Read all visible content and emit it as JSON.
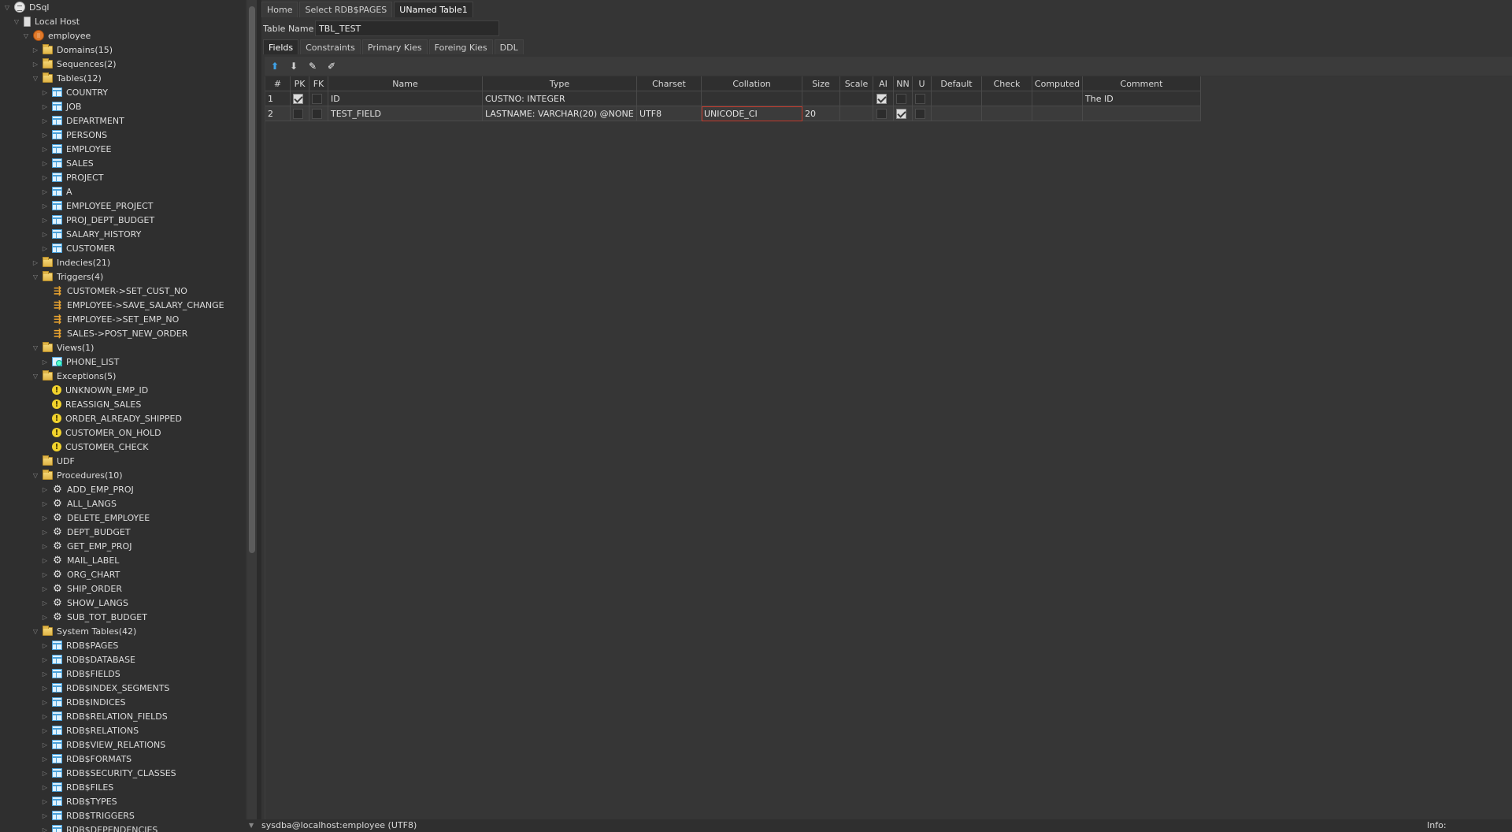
{
  "tree": [
    {
      "label": "DSql",
      "icon": "database-icon",
      "level": 0,
      "arrow": "open"
    },
    {
      "label": "Local Host",
      "icon": "server-icon",
      "level": 1,
      "arrow": "open"
    },
    {
      "label": "employee",
      "icon": "database-connection-icon",
      "level": 2,
      "arrow": "open"
    },
    {
      "label": "Domains(15)",
      "icon": "folder-icon",
      "level": 3,
      "arrow": "closed"
    },
    {
      "label": "Sequences(2)",
      "icon": "folder-icon",
      "level": 3,
      "arrow": "closed"
    },
    {
      "label": "Tables(12)",
      "icon": "folder-icon",
      "level": 3,
      "arrow": "open"
    },
    {
      "label": "COUNTRY",
      "icon": "table-icon",
      "level": 4,
      "arrow": "closed"
    },
    {
      "label": "JOB",
      "icon": "table-icon",
      "level": 4,
      "arrow": "closed"
    },
    {
      "label": "DEPARTMENT",
      "icon": "table-icon",
      "level": 4,
      "arrow": "closed"
    },
    {
      "label": "PERSONS",
      "icon": "table-icon",
      "level": 4,
      "arrow": "closed"
    },
    {
      "label": "EMPLOYEE",
      "icon": "table-icon",
      "level": 4,
      "arrow": "closed"
    },
    {
      "label": "SALES",
      "icon": "table-icon",
      "level": 4,
      "arrow": "closed"
    },
    {
      "label": "PROJECT",
      "icon": "table-icon",
      "level": 4,
      "arrow": "closed"
    },
    {
      "label": "A",
      "icon": "table-icon",
      "level": 4,
      "arrow": "closed"
    },
    {
      "label": "EMPLOYEE_PROJECT",
      "icon": "table-icon",
      "level": 4,
      "arrow": "closed"
    },
    {
      "label": "PROJ_DEPT_BUDGET",
      "icon": "table-icon",
      "level": 4,
      "arrow": "closed"
    },
    {
      "label": "SALARY_HISTORY",
      "icon": "table-icon",
      "level": 4,
      "arrow": "closed"
    },
    {
      "label": "CUSTOMER",
      "icon": "table-icon",
      "level": 4,
      "arrow": "closed"
    },
    {
      "label": "Indecies(21)",
      "icon": "folder-icon",
      "level": 3,
      "arrow": "closed"
    },
    {
      "label": "Triggers(4)",
      "icon": "folder-icon",
      "level": 3,
      "arrow": "open"
    },
    {
      "label": "CUSTOMER->SET_CUST_NO",
      "icon": "trigger-icon",
      "level": 4,
      "arrow": "none"
    },
    {
      "label": "EMPLOYEE->SAVE_SALARY_CHANGE",
      "icon": "trigger-icon",
      "level": 4,
      "arrow": "none"
    },
    {
      "label": "EMPLOYEE->SET_EMP_NO",
      "icon": "trigger-icon",
      "level": 4,
      "arrow": "none"
    },
    {
      "label": "SALES->POST_NEW_ORDER",
      "icon": "trigger-icon",
      "level": 4,
      "arrow": "none"
    },
    {
      "label": "Views(1)",
      "icon": "folder-icon",
      "level": 3,
      "arrow": "open"
    },
    {
      "label": "PHONE_LIST",
      "icon": "view-icon",
      "level": 4,
      "arrow": "closed"
    },
    {
      "label": "Exceptions(5)",
      "icon": "folder-icon",
      "level": 3,
      "arrow": "open"
    },
    {
      "label": "UNKNOWN_EMP_ID",
      "icon": "exception-icon",
      "level": 4,
      "arrow": "none"
    },
    {
      "label": "REASSIGN_SALES",
      "icon": "exception-icon",
      "level": 4,
      "arrow": "none"
    },
    {
      "label": "ORDER_ALREADY_SHIPPED",
      "icon": "exception-icon",
      "level": 4,
      "arrow": "none"
    },
    {
      "label": "CUSTOMER_ON_HOLD",
      "icon": "exception-icon",
      "level": 4,
      "arrow": "none"
    },
    {
      "label": "CUSTOMER_CHECK",
      "icon": "exception-icon",
      "level": 4,
      "arrow": "none"
    },
    {
      "label": "UDF",
      "icon": "folder-icon",
      "level": 3,
      "arrow": "none"
    },
    {
      "label": "Procedures(10)",
      "icon": "folder-icon",
      "level": 3,
      "arrow": "open"
    },
    {
      "label": "ADD_EMP_PROJ",
      "icon": "procedure-gear-icon",
      "level": 4,
      "arrow": "closed"
    },
    {
      "label": "ALL_LANGS",
      "icon": "procedure-gear-icon",
      "level": 4,
      "arrow": "closed"
    },
    {
      "label": "DELETE_EMPLOYEE",
      "icon": "procedure-gear-icon",
      "level": 4,
      "arrow": "closed"
    },
    {
      "label": "DEPT_BUDGET",
      "icon": "procedure-gear-icon",
      "level": 4,
      "arrow": "closed"
    },
    {
      "label": "GET_EMP_PROJ",
      "icon": "procedure-gear-icon",
      "level": 4,
      "arrow": "closed"
    },
    {
      "label": "MAIL_LABEL",
      "icon": "procedure-gear-icon",
      "level": 4,
      "arrow": "closed"
    },
    {
      "label": "ORG_CHART",
      "icon": "procedure-gear-icon",
      "level": 4,
      "arrow": "closed"
    },
    {
      "label": "SHIP_ORDER",
      "icon": "procedure-gear-icon",
      "level": 4,
      "arrow": "closed"
    },
    {
      "label": "SHOW_LANGS",
      "icon": "procedure-gear-icon",
      "level": 4,
      "arrow": "closed"
    },
    {
      "label": "SUB_TOT_BUDGET",
      "icon": "procedure-gear-icon",
      "level": 4,
      "arrow": "closed"
    },
    {
      "label": "System Tables(42)",
      "icon": "folder-icon",
      "level": 3,
      "arrow": "open"
    },
    {
      "label": "RDB$PAGES",
      "icon": "table-icon",
      "level": 4,
      "arrow": "closed"
    },
    {
      "label": "RDB$DATABASE",
      "icon": "table-icon",
      "level": 4,
      "arrow": "closed"
    },
    {
      "label": "RDB$FIELDS",
      "icon": "table-icon",
      "level": 4,
      "arrow": "closed"
    },
    {
      "label": "RDB$INDEX_SEGMENTS",
      "icon": "table-icon",
      "level": 4,
      "arrow": "closed"
    },
    {
      "label": "RDB$INDICES",
      "icon": "table-icon",
      "level": 4,
      "arrow": "closed"
    },
    {
      "label": "RDB$RELATION_FIELDS",
      "icon": "table-icon",
      "level": 4,
      "arrow": "closed"
    },
    {
      "label": "RDB$RELATIONS",
      "icon": "table-icon",
      "level": 4,
      "arrow": "closed"
    },
    {
      "label": "RDB$VIEW_RELATIONS",
      "icon": "table-icon",
      "level": 4,
      "arrow": "closed"
    },
    {
      "label": "RDB$FORMATS",
      "icon": "table-icon",
      "level": 4,
      "arrow": "closed"
    },
    {
      "label": "RDB$SECURITY_CLASSES",
      "icon": "table-icon",
      "level": 4,
      "arrow": "closed"
    },
    {
      "label": "RDB$FILES",
      "icon": "table-icon",
      "level": 4,
      "arrow": "closed"
    },
    {
      "label": "RDB$TYPES",
      "icon": "table-icon",
      "level": 4,
      "arrow": "closed"
    },
    {
      "label": "RDB$TRIGGERS",
      "icon": "table-icon",
      "level": 4,
      "arrow": "closed"
    },
    {
      "label": "RDB$DEPENDENCIES",
      "icon": "table-icon",
      "level": 4,
      "arrow": "closed"
    }
  ],
  "main_tabs": [
    "Home",
    "Select RDB$PAGES",
    "UNamed Table1"
  ],
  "active_main_tab": 2,
  "table_name": {
    "label": "Table Name :",
    "value": "TBL_TEST"
  },
  "sub_tabs": [
    "Fields",
    "Constraints",
    "Primary Kies",
    "Foreing Kies",
    "DDL"
  ],
  "active_sub_tab": 0,
  "toolbar": {
    "up": "move-up-arrow-icon",
    "down": "move-down-arrow-icon",
    "add": "add-field-icon",
    "remove": "remove-field-icon"
  },
  "grid": {
    "columns": [
      "#",
      "PK",
      "FK",
      "Name",
      "Type",
      "Charset",
      "Collation",
      "Size",
      "Scale",
      "AI",
      "NN",
      "U",
      "Default",
      "Check",
      "Computed",
      "Comment"
    ],
    "rows": [
      {
        "num": "1",
        "pk": true,
        "fk": false,
        "name": "ID",
        "type": "CUSTNO:  INTEGER",
        "charset": "",
        "collation": "",
        "size": "",
        "scale": "",
        "ai": true,
        "nn": false,
        "u": false,
        "default": "",
        "check": "",
        "computed": "",
        "comment": "The ID"
      },
      {
        "num": "2",
        "pk": false,
        "fk": false,
        "name": "TEST_FIELD",
        "type": "LASTNAME:  VARCHAR(20) @NONE",
        "charset": "UTF8",
        "collation": "UNICODE_CI",
        "size": "20",
        "scale": "",
        "ai": false,
        "nn": true,
        "u": false,
        "default": "",
        "check": "",
        "computed": "",
        "comment": ""
      }
    ]
  },
  "status": {
    "connection": "sysdba@localhost:employee  (UTF8)",
    "info": "Info:"
  }
}
